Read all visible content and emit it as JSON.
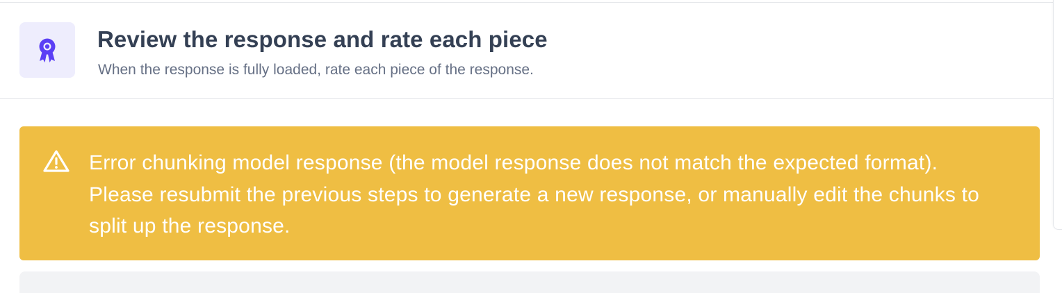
{
  "step": {
    "icon": "award-ribbon-icon",
    "icon_color": "#5b3ff5",
    "title": "Review the response and rate each piece",
    "subtitle": "When the response is fully loaded, rate each piece of the response."
  },
  "alert": {
    "icon": "warning-triangle-icon",
    "background_color": "#efbe43",
    "message": "Error chunking model response (the model response does not match the expected format). Please resubmit the previous steps to generate a new response, or manually edit the chunks to split up the response."
  }
}
